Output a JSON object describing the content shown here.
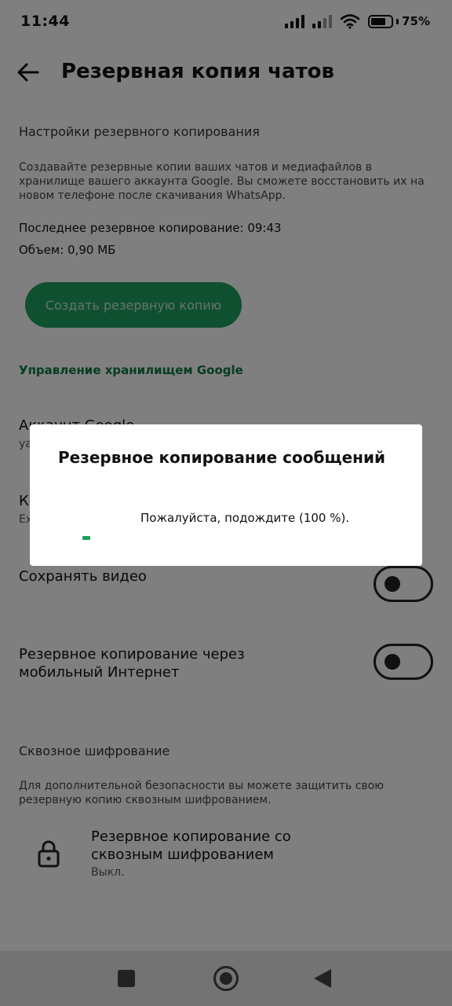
{
  "status_bar": {
    "time": "11:44",
    "battery": "75%"
  },
  "app_bar": {
    "title": "Резервная копия чатов"
  },
  "backup_settings": {
    "heading": "Настройки резервного копирования",
    "description": "Создавайте резервные копии ваших чатов и медиафайлов в хранилище вашего аккаунта Google. Вы сможете восстановить их на новом телефоне после скачивания WhatsApp.",
    "last_backup": "Последнее резервное копирование: 09:43",
    "size": "Объем: 0,90 МБ",
    "backup_button": "Создать резервную копию",
    "manage_storage_link": "Управление хранилищем Google"
  },
  "settings": {
    "account_title": "Аккаунт Google",
    "account_sub": "ya",
    "frequency_title": "Ка",
    "frequency_sub": "Ex",
    "save_video": {
      "label": "Сохранять видео",
      "checked": false
    },
    "mobile_data": {
      "label": "Резервное копирование через мобильный Интернет",
      "checked": false
    }
  },
  "e2e": {
    "heading": "Сквозное шифрование",
    "description": "Для дополнительной безопасности вы можете защитить свою резервную копию сквозным шифрованием.",
    "item_title": "Резервное копирование со сквозным шифрованием",
    "item_status": "Выкл."
  },
  "dialog": {
    "title": "Резервное копирование сообщений",
    "message": "Пожалуйста, подождите (100 %).",
    "progress_percent": 100
  },
  "colors": {
    "accent": "#1ea060",
    "link": "#0d7a3e",
    "scrim": "rgba(0,0,0,0.5)"
  }
}
